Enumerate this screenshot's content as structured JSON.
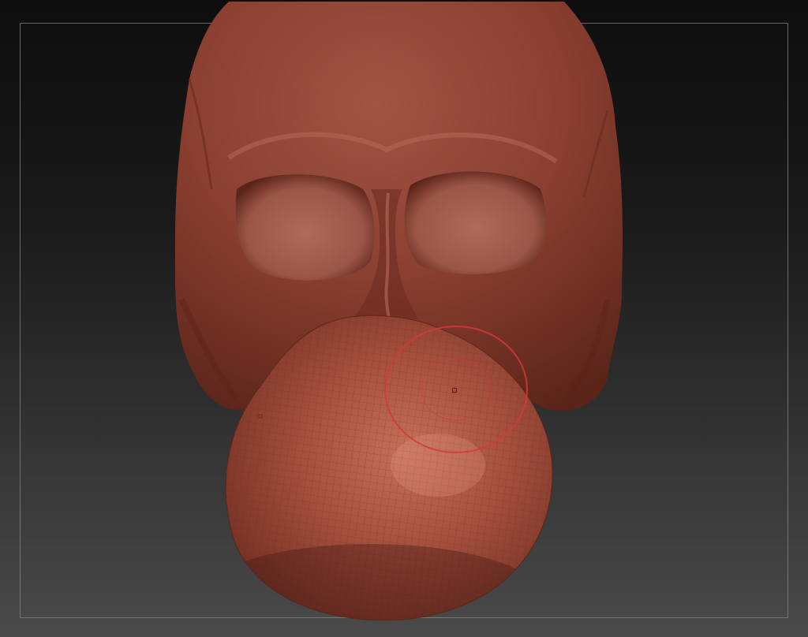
{
  "app": {
    "viewport_kind": "3D sculpting canvas"
  },
  "scene": {
    "model_color": "#8e4233",
    "background_top": "#0f0f0f",
    "background_bottom": "#4a4a4a",
    "frame_color": "#8a8a8a"
  },
  "brush": {
    "cursor_color": "#d23a3a",
    "icon": "brush-cursor-icon"
  }
}
